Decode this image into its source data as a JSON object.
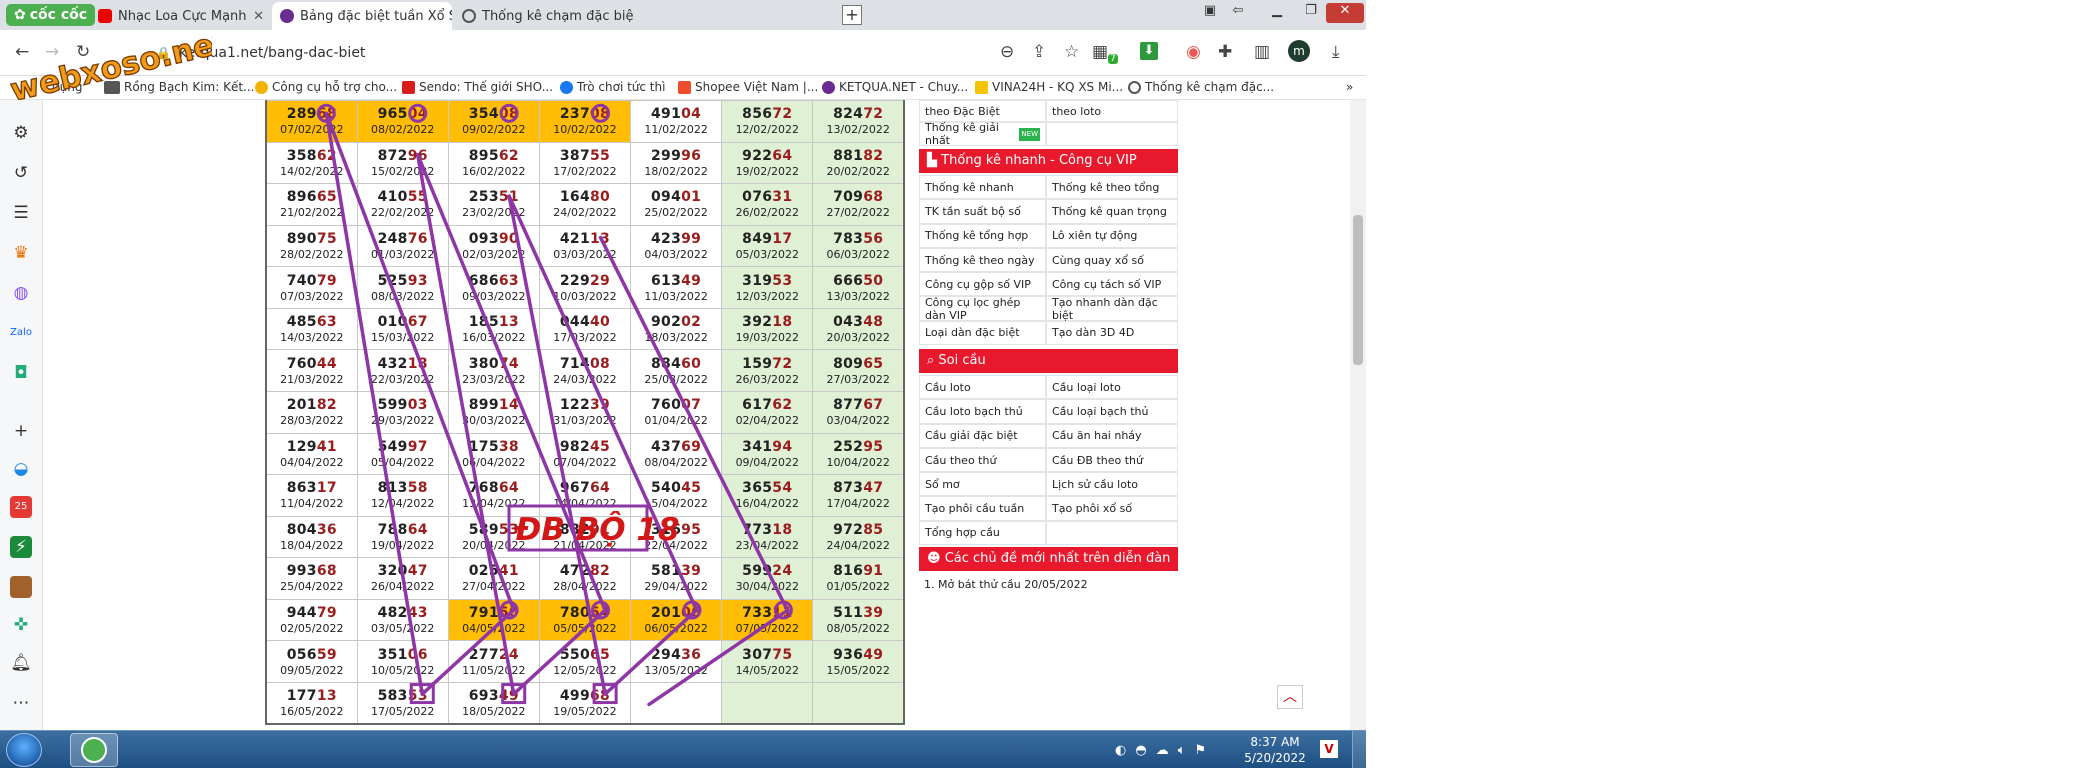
{
  "colors": {
    "accent_red": "#e8192c",
    "highlight_orange": "#ffbd06",
    "green_cell": "#dff0d5",
    "marker_purple": "#8e36a6",
    "number_red": "#9b1c1c"
  },
  "watermark": "webxoso.net",
  "browser": {
    "brand": "cốc cốc",
    "tabs": [
      {
        "label": "Nhạc Loa Cực Mạnh",
        "icon": "youtube-icon"
      },
      {
        "label": "Bảng đặc biệt tuần Xổ Số Tru",
        "icon": "ketqua-icon"
      },
      {
        "label": "Thống kê chạm đặc biệt ngà",
        "icon": "globe-icon"
      }
    ],
    "url": "ketqua1.net/bang-dac-biet",
    "profile_initial": "m",
    "extension_badge": "7"
  },
  "bookmarks": [
    {
      "label": "dụng",
      "icon": "apps-icon"
    },
    {
      "label": "Rồng Bạch Kim: Kết...",
      "icon": "rbk-icon"
    },
    {
      "label": "Công cụ hỗ trợ cho...",
      "icon": "tool-icon"
    },
    {
      "label": "Sendo: Thế giới SHO...",
      "icon": "sendo-icon"
    },
    {
      "label": "Trò chơi tức thì",
      "icon": "facebook-icon"
    },
    {
      "label": "Shopee Việt Nam |...",
      "icon": "shopee-icon"
    },
    {
      "label": "KETQUA.NET - Chuy...",
      "icon": "ketqua-icon"
    },
    {
      "label": "VINA24H - KQ XS Mi...",
      "icon": "vina24h-icon"
    },
    {
      "label": "Thống kê chạm đặc...",
      "icon": "globe-icon"
    }
  ],
  "results": [
    [
      {
        "n": "28968",
        "d": "07/02/2022",
        "hl": true
      },
      {
        "n": "96504",
        "d": "08/02/2022",
        "hl": true
      },
      {
        "n": "35408",
        "d": "09/02/2022",
        "hl": true
      },
      {
        "n": "23708",
        "d": "10/02/2022",
        "hl": true
      },
      {
        "n": "49104",
        "d": "11/02/2022"
      },
      {
        "n": "85672",
        "d": "12/02/2022"
      },
      {
        "n": "82472",
        "d": "13/02/2022"
      }
    ],
    [
      {
        "n": "35862",
        "d": "14/02/2022"
      },
      {
        "n": "87296",
        "d": "15/02/2022"
      },
      {
        "n": "89562",
        "d": "16/02/2022"
      },
      {
        "n": "38755",
        "d": "17/02/2022"
      },
      {
        "n": "29996",
        "d": "18/02/2022"
      },
      {
        "n": "92264",
        "d": "19/02/2022"
      },
      {
        "n": "88182",
        "d": "20/02/2022"
      }
    ],
    [
      {
        "n": "89665",
        "d": "21/02/2022"
      },
      {
        "n": "41055",
        "d": "22/02/2022"
      },
      {
        "n": "25351",
        "d": "23/02/2022"
      },
      {
        "n": "16480",
        "d": "24/02/2022"
      },
      {
        "n": "09401",
        "d": "25/02/2022"
      },
      {
        "n": "07631",
        "d": "26/02/2022"
      },
      {
        "n": "70968",
        "d": "27/02/2022"
      }
    ],
    [
      {
        "n": "89075",
        "d": "28/02/2022"
      },
      {
        "n": "24876",
        "d": "01/03/2022"
      },
      {
        "n": "09390",
        "d": "02/03/2022"
      },
      {
        "n": "42113",
        "d": "03/03/2022"
      },
      {
        "n": "42399",
        "d": "04/03/2022"
      },
      {
        "n": "84917",
        "d": "05/03/2022"
      },
      {
        "n": "78356",
        "d": "06/03/2022"
      }
    ],
    [
      {
        "n": "74079",
        "d": "07/03/2022"
      },
      {
        "n": "52593",
        "d": "08/03/2022"
      },
      {
        "n": "68663",
        "d": "09/03/2022"
      },
      {
        "n": "22929",
        "d": "10/03/2022"
      },
      {
        "n": "61349",
        "d": "11/03/2022"
      },
      {
        "n": "31953",
        "d": "12/03/2022"
      },
      {
        "n": "66650",
        "d": "13/03/2022"
      }
    ],
    [
      {
        "n": "48563",
        "d": "14/03/2022"
      },
      {
        "n": "01067",
        "d": "15/03/2022"
      },
      {
        "n": "18513",
        "d": "16/03/2022"
      },
      {
        "n": "04440",
        "d": "17/03/2022"
      },
      {
        "n": "90202",
        "d": "18/03/2022"
      },
      {
        "n": "39218",
        "d": "19/03/2022"
      },
      {
        "n": "04348",
        "d": "20/03/2022"
      }
    ],
    [
      {
        "n": "76044",
        "d": "21/03/2022"
      },
      {
        "n": "43218",
        "d": "22/03/2022"
      },
      {
        "n": "38074",
        "d": "23/03/2022"
      },
      {
        "n": "71408",
        "d": "24/03/2022"
      },
      {
        "n": "88460",
        "d": "25/03/2022"
      },
      {
        "n": "15972",
        "d": "26/03/2022"
      },
      {
        "n": "80965",
        "d": "27/03/2022"
      }
    ],
    [
      {
        "n": "20182",
        "d": "28/03/2022"
      },
      {
        "n": "59903",
        "d": "29/03/2022"
      },
      {
        "n": "89914",
        "d": "30/03/2022"
      },
      {
        "n": "12239",
        "d": "31/03/2022"
      },
      {
        "n": "76007",
        "d": "01/04/2022"
      },
      {
        "n": "61762",
        "d": "02/04/2022"
      },
      {
        "n": "87767",
        "d": "03/04/2022"
      }
    ],
    [
      {
        "n": "12941",
        "d": "04/04/2022"
      },
      {
        "n": "54997",
        "d": "05/04/2022"
      },
      {
        "n": "17538",
        "d": "06/04/2022"
      },
      {
        "n": "98245",
        "d": "07/04/2022"
      },
      {
        "n": "43769",
        "d": "08/04/2022"
      },
      {
        "n": "34194",
        "d": "09/04/2022"
      },
      {
        "n": "25295",
        "d": "10/04/2022"
      }
    ],
    [
      {
        "n": "86317",
        "d": "11/04/2022"
      },
      {
        "n": "81358",
        "d": "12/04/2022"
      },
      {
        "n": "76864",
        "d": "13/04/2022"
      },
      {
        "n": "96764",
        "d": "14/04/2022"
      },
      {
        "n": "54045",
        "d": "15/04/2022"
      },
      {
        "n": "36554",
        "d": "16/04/2022"
      },
      {
        "n": "87347",
        "d": "17/04/2022"
      }
    ],
    [
      {
        "n": "80436",
        "d": "18/04/2022"
      },
      {
        "n": "78864",
        "d": "19/04/2022"
      },
      {
        "n": "58953",
        "d": "20/04/2022"
      },
      {
        "n": "88291",
        "d": "21/04/2022"
      },
      {
        "n": "31695",
        "d": "22/04/2022"
      },
      {
        "n": "77318",
        "d": "23/04/2022"
      },
      {
        "n": "97285",
        "d": "24/04/2022"
      }
    ],
    [
      {
        "n": "99368",
        "d": "25/04/2022"
      },
      {
        "n": "32047",
        "d": "26/04/2022"
      },
      {
        "n": "02541",
        "d": "27/04/2022"
      },
      {
        "n": "47282",
        "d": "28/04/2022"
      },
      {
        "n": "58139",
        "d": "29/04/2022"
      },
      {
        "n": "59924",
        "d": "30/04/2022"
      },
      {
        "n": "81691",
        "d": "01/05/2022"
      }
    ],
    [
      {
        "n": "94479",
        "d": "02/05/2022"
      },
      {
        "n": "48243",
        "d": "03/05/2022"
      },
      {
        "n": "79150",
        "d": "04/05/2022",
        "hl": true
      },
      {
        "n": "78054",
        "d": "05/05/2022",
        "hl": true
      },
      {
        "n": "20106",
        "d": "06/05/2022",
        "hl": true
      },
      {
        "n": "73311",
        "d": "07/05/2022",
        "hl": true
      },
      {
        "n": "51139",
        "d": "08/05/2022"
      }
    ],
    [
      {
        "n": "05659",
        "d": "09/05/2022"
      },
      {
        "n": "35106",
        "d": "10/05/2022"
      },
      {
        "n": "27724",
        "d": "11/05/2022"
      },
      {
        "n": "55065",
        "d": "12/05/2022"
      },
      {
        "n": "29436",
        "d": "13/05/2022"
      },
      {
        "n": "30775",
        "d": "14/05/2022"
      },
      {
        "n": "93649",
        "d": "15/05/2022"
      }
    ],
    [
      {
        "n": "17713",
        "d": "16/05/2022"
      },
      {
        "n": "58353",
        "d": "17/05/2022"
      },
      {
        "n": "69349",
        "d": "18/05/2022"
      },
      {
        "n": "49968",
        "d": "19/05/2022"
      },
      {
        "n": "",
        "d": ""
      },
      {
        "n": "",
        "d": ""
      },
      {
        "n": "",
        "d": ""
      }
    ]
  ],
  "annotation": "ĐB BỘ 18",
  "right_panel": {
    "top_cells": [
      "theo Đặc Biệt",
      "theo loto",
      "Thống kê giải nhất",
      ""
    ],
    "new_badge": "NEW",
    "vip_title": "Thống kê nhanh - Công cụ VIP",
    "vip_links": [
      "Thống kê nhanh",
      "Thống kê theo tổng",
      "TK tần suất bộ số",
      "Thống kê quan trọng",
      "Thống kê tổng hợp",
      "Lô xiên tự động",
      "Thống kê theo ngày",
      "Cùng quay xổ số",
      "Công cụ gộp số VIP",
      "Công cụ tách số VIP",
      "Công cụ lọc ghép dàn VIP",
      "Tạo nhanh dàn đặc biệt",
      "Loại dàn đặc biệt",
      "Tạo dàn 3D 4D"
    ],
    "soi_title": "Soi cầu",
    "soi_links": [
      "Cầu loto",
      "Cầu loại loto",
      "Cầu loto bạch thủ",
      "Cầu loại bạch thủ",
      "Cầu giải đặc biệt",
      "Cầu ăn hai nháy",
      "Cầu theo thứ",
      "Cầu ĐB theo thứ",
      "Sổ mơ",
      "Lịch sử cầu loto",
      "Tạo phôi cầu tuần",
      "Tạo phôi xổ số",
      "Tổng hợp cầu",
      ""
    ],
    "forum_title": "Các chủ đề mới nhất trên diễn đàn",
    "forum_item": "1. Mở bát thử cầu 20/05/2022"
  },
  "taskbar": {
    "time": "8:37 AM",
    "date": "5/20/2022"
  }
}
